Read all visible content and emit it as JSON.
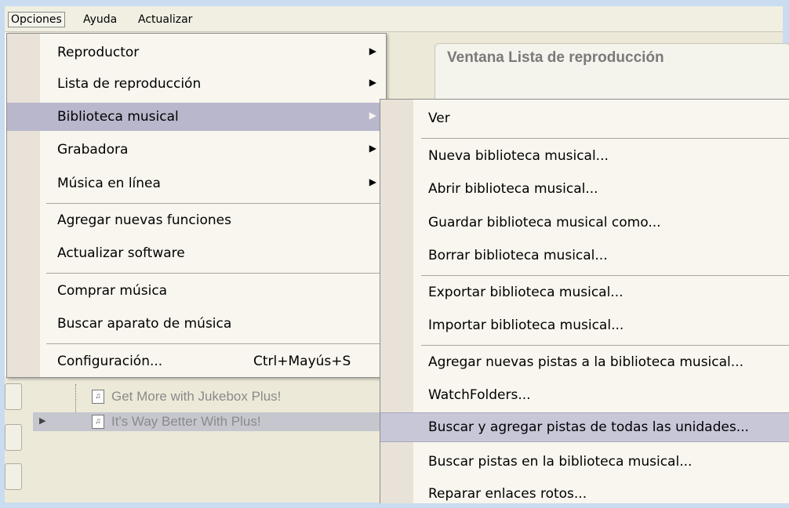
{
  "menubar": {
    "items": [
      "Opciones",
      "Ayuda",
      "Actualizar"
    ]
  },
  "playlist_window": {
    "title": "Ventana Lista de reproducción"
  },
  "tree": {
    "items": [
      "Get More with Jukebox Plus!",
      "It's Way Better With Plus!"
    ]
  },
  "options_menu": {
    "items": [
      {
        "label": "Reproductor",
        "submenu": true
      },
      {
        "label": "Lista de reproducción",
        "submenu": true
      },
      {
        "label": "Biblioteca musical",
        "submenu": true,
        "highlighted": true
      },
      {
        "label": "Grabadora",
        "submenu": true
      },
      {
        "label": "Música en línea",
        "submenu": true
      },
      {
        "label": "Agregar nuevas funciones"
      },
      {
        "label": "Actualizar software"
      },
      {
        "label": "Comprar música"
      },
      {
        "label": "Buscar aparato de música"
      },
      {
        "label": "Configuración...",
        "shortcut": "Ctrl+Mayús+S"
      }
    ]
  },
  "library_submenu": {
    "items": [
      {
        "label": "Ver"
      },
      {
        "label": "Nueva biblioteca musical..."
      },
      {
        "label": "Abrir biblioteca musical..."
      },
      {
        "label": "Guardar biblioteca musical como..."
      },
      {
        "label": "Borrar biblioteca musical..."
      },
      {
        "label": "Exportar biblioteca musical..."
      },
      {
        "label": "Importar biblioteca musical..."
      },
      {
        "label": "Agregar nuevas pistas a la biblioteca musical..."
      },
      {
        "label": "WatchFolders..."
      },
      {
        "label": "Buscar y agregar pistas de todas las unidades...",
        "highlighted": true
      },
      {
        "label": "Buscar pistas en la biblioteca musical..."
      },
      {
        "label": "Reparar enlaces rotos..."
      }
    ]
  },
  "icons": {
    "submenu_arrow": "submenu-arrow-icon",
    "track": "music-file-icon",
    "expand": "expand-triangle-icon"
  },
  "colors": {
    "highlight": "#b9b7cc",
    "menu_bg": "#f8f6ee",
    "gutter": "#e8e2d8",
    "frame": "#c9dcf0"
  }
}
